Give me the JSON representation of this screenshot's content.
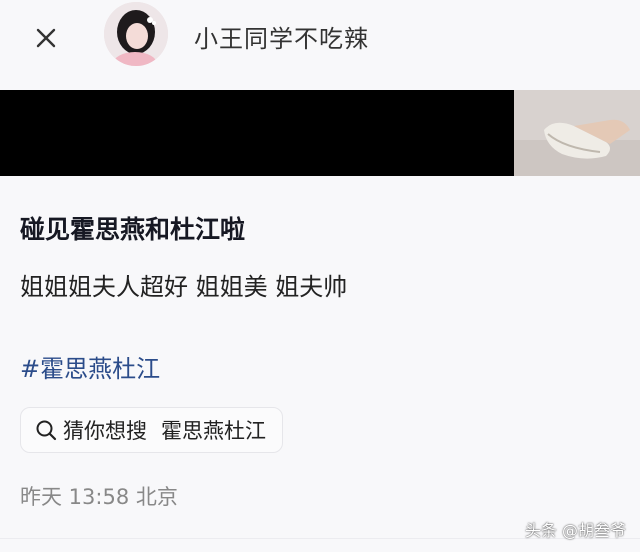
{
  "header": {
    "author_name": "小王同学不吃辣",
    "close_icon": "close-icon",
    "avatar_icon": "avatar"
  },
  "post": {
    "title": "碰见霍思燕和杜江啦",
    "text": "姐姐姐夫人超好 姐姐美 姐夫帅",
    "hashtag": "#霍思燕杜江",
    "search_suggestion": {
      "prefix": "猜你想搜",
      "query": "霍思燕杜江",
      "icon": "search-icon"
    },
    "meta": "昨天 13:58 北京"
  },
  "watermark": "头条 @胡叁爷",
  "colors": {
    "background": "#f8f8fa",
    "hashtag": "#2b4c8a",
    "meta": "#888888"
  }
}
